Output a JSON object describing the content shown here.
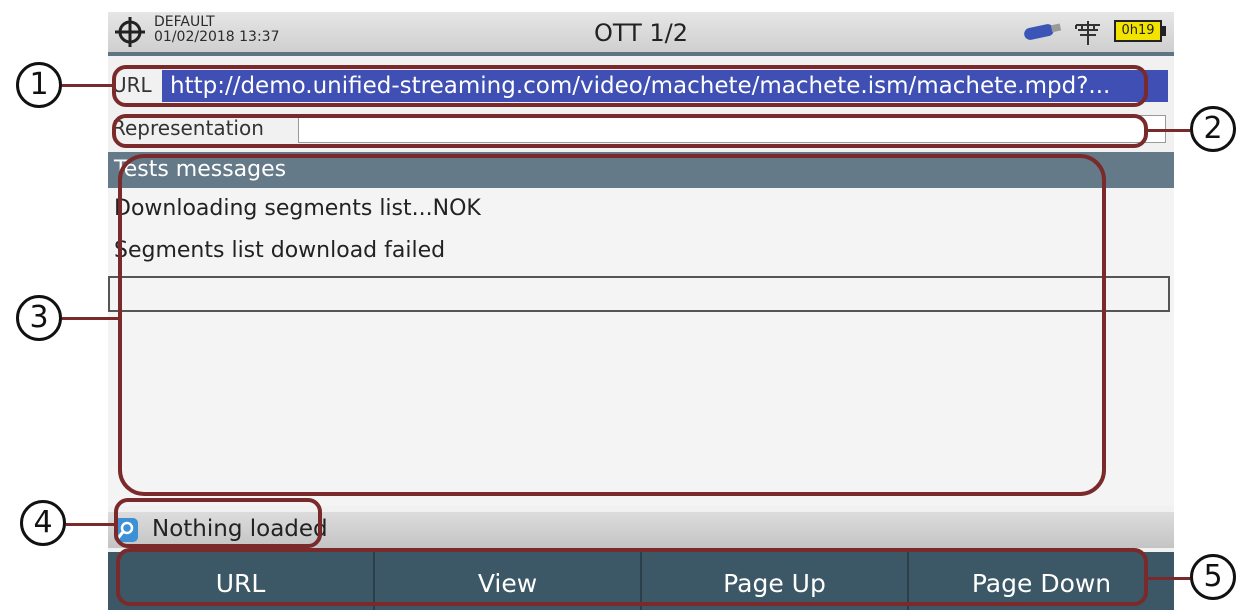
{
  "statusbar": {
    "profile_name": "DEFAULT",
    "datetime": "01/02/2018 13:37",
    "title": "OTT 1/2",
    "battery_time": "0h19"
  },
  "url": {
    "label": "URL",
    "value": "http://demo.unified-streaming.com/video/machete/machete.ism/machete.mpd?..."
  },
  "representation": {
    "label": "Representation",
    "value": ""
  },
  "tests": {
    "header": "Tests messages",
    "messages": [
      "Downloading segments list...NOK",
      "Segments list download failed"
    ]
  },
  "loader": {
    "status_text": "Nothing loaded"
  },
  "softkeys": [
    "URL",
    "View",
    "Page Up",
    "Page Down"
  ],
  "callouts": [
    "1",
    "2",
    "3",
    "4",
    "5"
  ],
  "colors": {
    "accent": "#3f4fb3",
    "header": "#647a89",
    "softkeys": "#3c5866",
    "callout": "#7a2a2a"
  }
}
